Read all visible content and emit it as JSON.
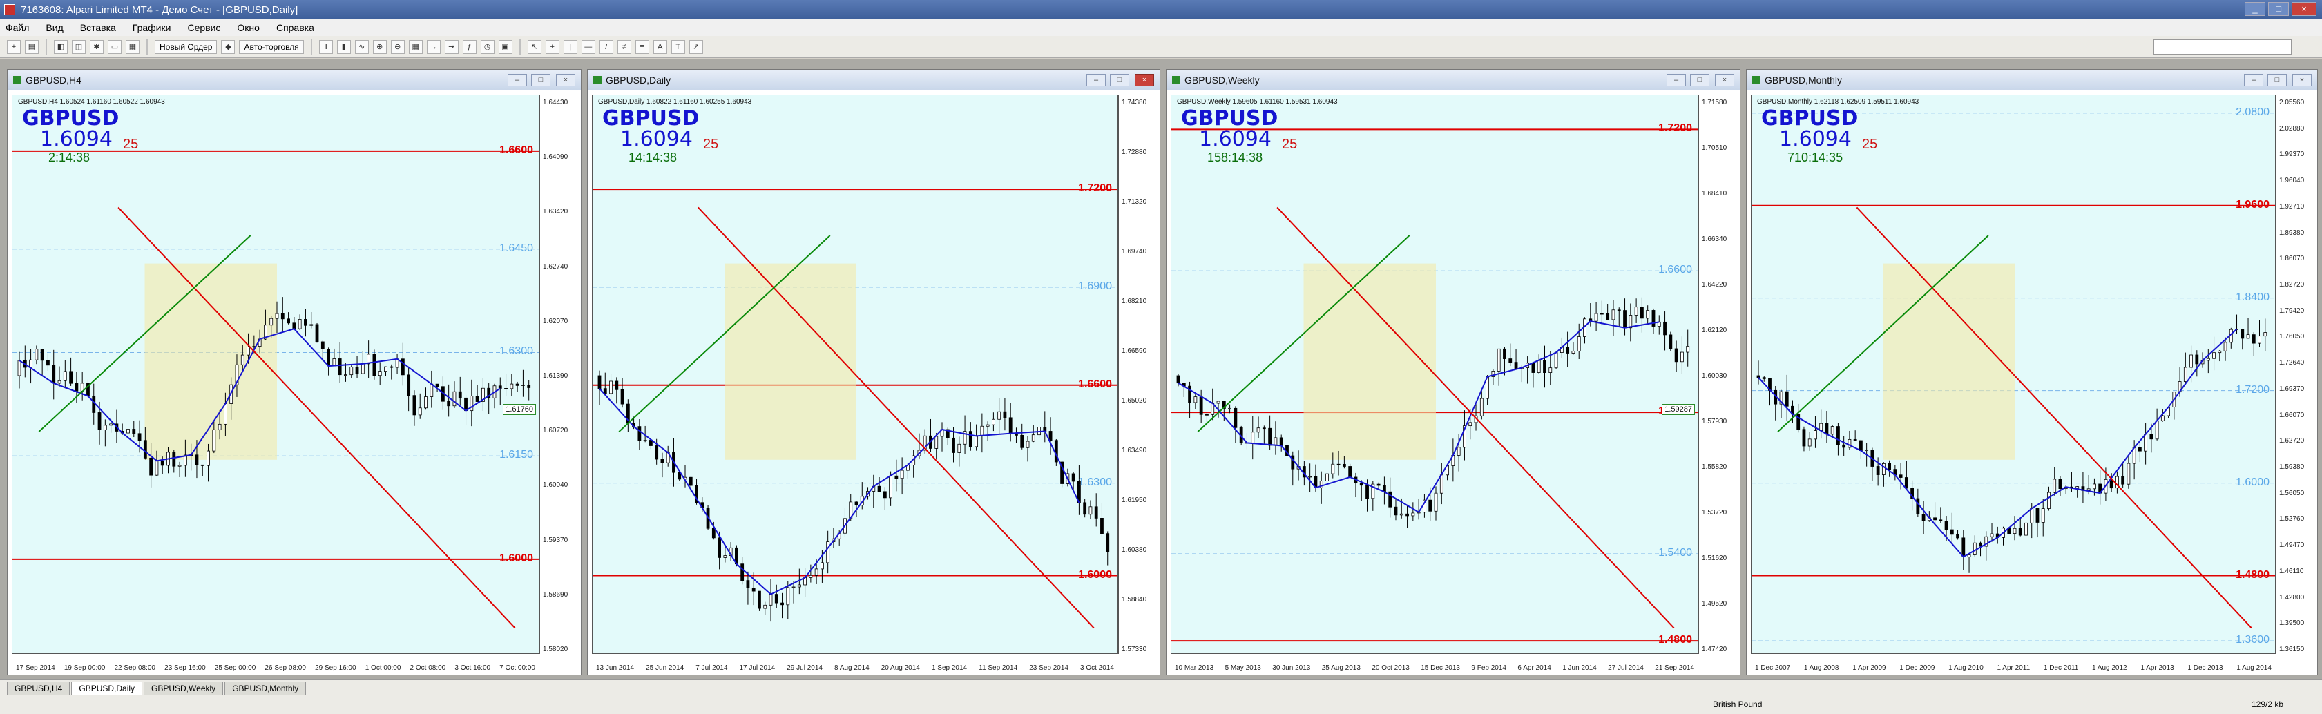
{
  "window": {
    "title": "7163608: Alpari Limited MT4 - Демо Счет - [GBPUSD,Daily]"
  },
  "menu": [
    "Файл",
    "Вид",
    "Вставка",
    "Графики",
    "Сервис",
    "Окно",
    "Справка"
  ],
  "toolbar": {
    "new_order": "Новый Ордер",
    "auto_trading": "Авто-торговля"
  },
  "charts": [
    {
      "title": "GBPUSD,H4",
      "ohlc": "GBPUSD,H4 1.60524 1.61160 1.60522 1.60943",
      "symbol": "GBPUSD",
      "bid": "1.6094",
      "bid_sup": "25",
      "timer": "2:14:38",
      "levels": [
        {
          "text": "1.6600",
          "cls": "red",
          "y": 0.09
        },
        {
          "text": "1.6450",
          "cls": "lblue",
          "y": 0.27
        },
        {
          "text": "1.6300",
          "cls": "lblue",
          "y": 0.46
        },
        {
          "text": "1.6150",
          "cls": "lblue",
          "y": 0.65
        },
        {
          "text": "1.6000",
          "cls": "red",
          "y": 0.84
        }
      ],
      "callout": "1.61760",
      "prices": [
        "1.64430",
        "1.64090",
        "1.63420",
        "1.62740",
        "1.62070",
        "1.61390",
        "1.60720",
        "1.60040",
        "1.59370",
        "1.58690",
        "1.58020"
      ],
      "times": [
        "17 Sep 2014",
        "19 Sep 00:00",
        "22 Sep 08:00",
        "23 Sep 16:00",
        "25 Sep 00:00",
        "26 Sep 08:00",
        "29 Sep 16:00",
        "1 Oct 00:00",
        "2 Oct 08:00",
        "3 Oct 16:00",
        "7 Oct 00:00"
      ]
    },
    {
      "title": "GBPUSD,Daily",
      "ohlc": "GBPUSD,Daily 1.60822 1.61160 1.60255 1.60943",
      "symbol": "GBPUSD",
      "bid": "1.6094",
      "bid_sup": "25",
      "timer": "14:14:38",
      "levels": [
        {
          "text": "1.7200",
          "cls": "red",
          "y": 0.16
        },
        {
          "text": "1.6900",
          "cls": "lblue",
          "y": 0.34
        },
        {
          "text": "1.6600",
          "cls": "red",
          "y": 0.52
        },
        {
          "text": "1.6300",
          "cls": "lblue",
          "y": 0.7
        },
        {
          "text": "1.6000",
          "cls": "red",
          "y": 0.87
        }
      ],
      "callout": "",
      "prices": [
        "1.74380",
        "1.72880",
        "1.71320",
        "1.69740",
        "1.68210",
        "1.66590",
        "1.65020",
        "1.63490",
        "1.61950",
        "1.60380",
        "1.58840",
        "1.57330"
      ],
      "times": [
        "13 Jun 2014",
        "25 Jun 2014",
        "7 Jul 2014",
        "17 Jul 2014",
        "29 Jul 2014",
        "8 Aug 2014",
        "20 Aug 2014",
        "1 Sep 2014",
        "11 Sep 2014",
        "23 Sep 2014",
        "3 Oct 2014"
      ]
    },
    {
      "title": "GBPUSD,Weekly",
      "ohlc": "GBPUSD,Weekly 1.59605 1.61160 1.59531 1.60943",
      "symbol": "GBPUSD",
      "bid": "1.6094",
      "bid_sup": "25",
      "timer": "158:14:38",
      "levels": [
        {
          "text": "1.7200",
          "cls": "red",
          "y": 0.05
        },
        {
          "text": "1.6600",
          "cls": "lblue",
          "y": 0.31
        },
        {
          "text": "1.6000",
          "cls": "red",
          "y": 0.57
        },
        {
          "text": "1.5400",
          "cls": "lblue",
          "y": 0.83
        },
        {
          "text": "1.4800",
          "cls": "red",
          "y": 0.99
        }
      ],
      "callout": "1.59287",
      "prices": [
        "1.71580",
        "1.70510",
        "1.68410",
        "1.66340",
        "1.64220",
        "1.62120",
        "1.60030",
        "1.57930",
        "1.55820",
        "1.53720",
        "1.51620",
        "1.49520",
        "1.47420"
      ],
      "times": [
        "10 Mar 2013",
        "5 May 2013",
        "30 Jun 2013",
        "25 Aug 2013",
        "20 Oct 2013",
        "15 Dec 2013",
        "9 Feb 2014",
        "6 Apr 2014",
        "1 Jun 2014",
        "27 Jul 2014",
        "21 Sep 2014"
      ]
    },
    {
      "title": "GBPUSD,Monthly",
      "ohlc": "GBPUSD,Monthly 1.62118 1.62509 1.59511 1.60943",
      "symbol": "GBPUSD",
      "bid": "1.6094",
      "bid_sup": "25",
      "timer": "710:14:35",
      "levels": [
        {
          "text": "2.0800",
          "cls": "lblue",
          "y": 0.02
        },
        {
          "text": "1.9600",
          "cls": "red",
          "y": 0.19
        },
        {
          "text": "1.8400",
          "cls": "lblue",
          "y": 0.36
        },
        {
          "text": "1.7200",
          "cls": "lblue",
          "y": 0.53
        },
        {
          "text": "1.6000",
          "cls": "lblue",
          "y": 0.7
        },
        {
          "text": "1.4800",
          "cls": "red",
          "y": 0.87
        },
        {
          "text": "1.3600",
          "cls": "lblue",
          "y": 0.99
        }
      ],
      "callout": "",
      "prices": [
        "2.05560",
        "2.02880",
        "1.99370",
        "1.96040",
        "1.92710",
        "1.89380",
        "1.86070",
        "1.82720",
        "1.79420",
        "1.76050",
        "1.72640",
        "1.69370",
        "1.66070",
        "1.62720",
        "1.59380",
        "1.56050",
        "1.52760",
        "1.49470",
        "1.46110",
        "1.42800",
        "1.39500",
        "1.36150"
      ],
      "times": [
        "1 Dec 2007",
        "1 Aug 2008",
        "1 Apr 2009",
        "1 Dec 2009",
        "1 Aug 2010",
        "1 Apr 2011",
        "1 Dec 2011",
        "1 Aug 2012",
        "1 Apr 2013",
        "1 Dec 2013",
        "1 Aug 2014"
      ]
    }
  ],
  "tabs": [
    "GBPUSD,H4",
    "GBPUSD,Daily",
    "GBPUSD,Weekly",
    "GBPUSD,Monthly"
  ],
  "status": {
    "profile": "British Pound",
    "traffic": "129/2 kb"
  },
  "colors": {
    "background": "#e3fafa",
    "bull": "#1414d0",
    "bear": "#e00000",
    "support": "#0a8a0a"
  }
}
